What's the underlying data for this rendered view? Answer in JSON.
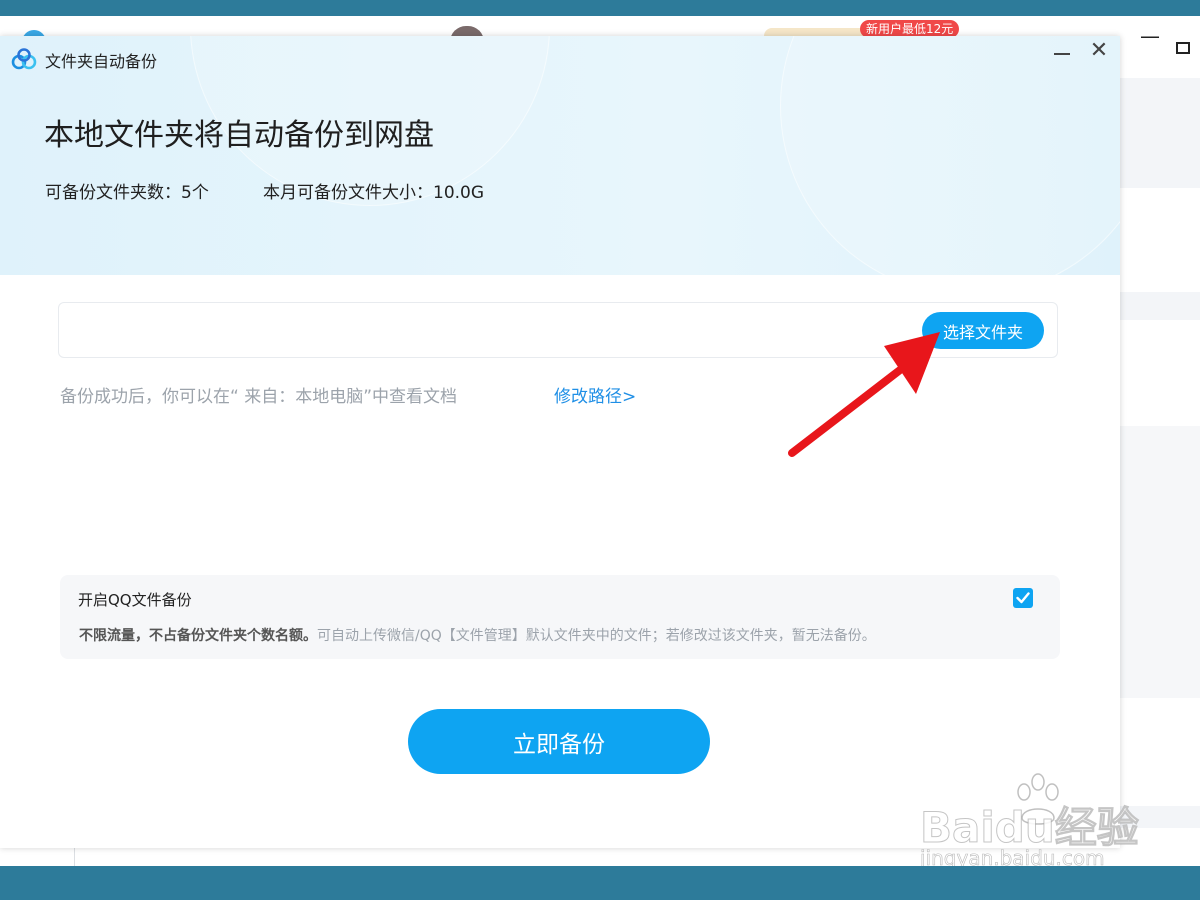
{
  "background_app": {
    "badge": "新用户最低12元"
  },
  "dialog": {
    "title": "文件夹自动备份",
    "headline": "本地文件夹将自动备份到网盘",
    "quota": {
      "folders": "可备份文件夹数：5个",
      "size": "本月可备份文件大小：10.0G"
    },
    "path_input": {
      "value": ""
    },
    "select_folder_label": "选择文件夹",
    "hint": "备份成功后，你可以在“ 来自：本地电脑”中查看文档",
    "modify_path_label": "修改路径>",
    "qq_backup": {
      "title": "开启QQ文件备份",
      "desc_bold": "不限流量，不占备份文件夹个数名额。",
      "desc": "可自动上传微信/QQ【文件管理】默认文件夹中的文件；若修改过该文件夹，暂无法备份。",
      "checked": true
    },
    "backup_now_label": "立即备份"
  },
  "watermark": {
    "brand": "Baidu经验",
    "url": "jingyan.baidu.com"
  },
  "colors": {
    "accent": "#0ea4f2",
    "link": "#1f8fe6",
    "header_bg": "#e2f3fb",
    "annotation_arrow": "#e8161b",
    "frame": "#2d7b9a"
  },
  "icons": [
    "baidu-netdisk-logo-icon",
    "minimize-icon",
    "close-icon",
    "checkbox-checked-icon",
    "red-annotation-arrow"
  ]
}
